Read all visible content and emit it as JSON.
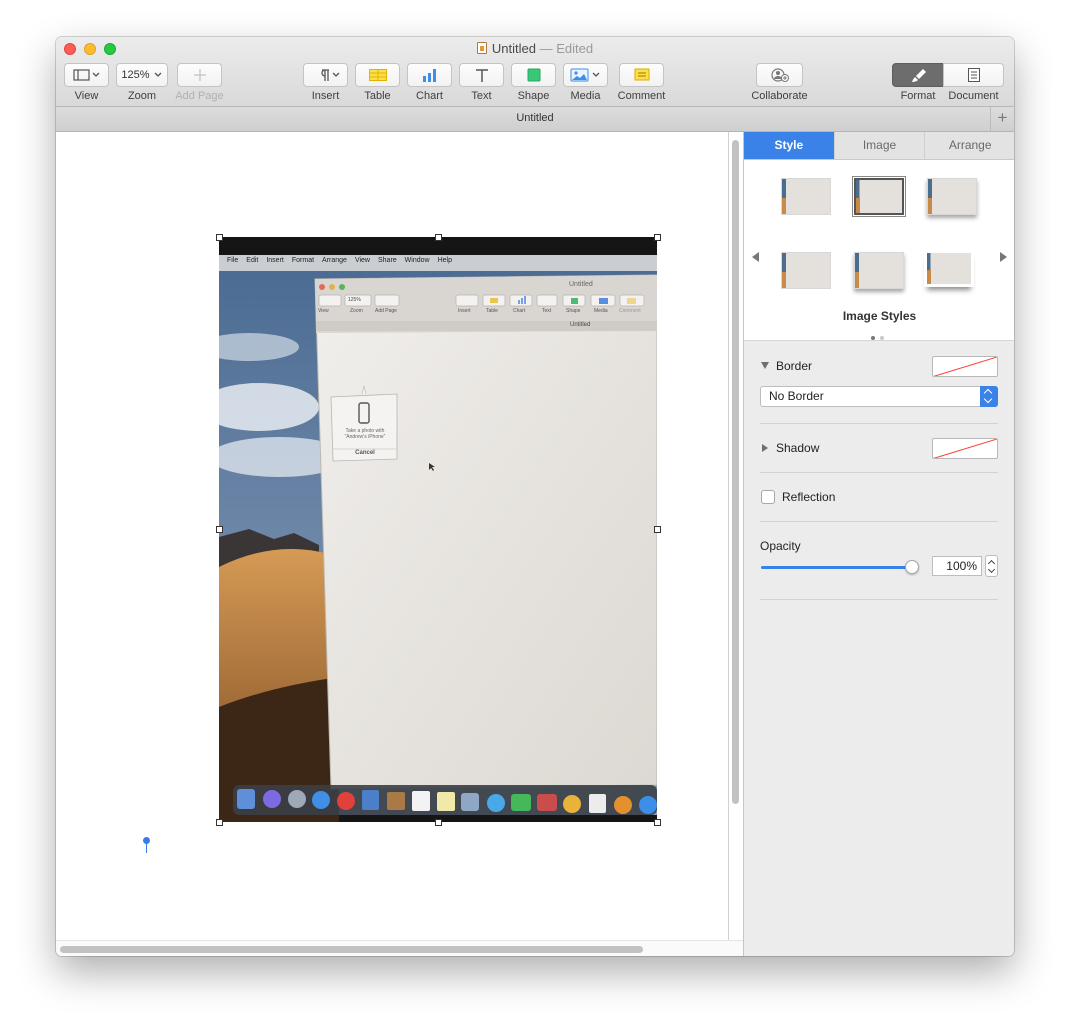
{
  "window": {
    "title": "Untitled",
    "edited_suffix": "— Edited",
    "document_tab_title": "Untitled"
  },
  "toolbar": {
    "view_label": "View",
    "zoom_label": "Zoom",
    "zoom_value": "125%",
    "add_page_label": "Add Page",
    "insert_label": "Insert",
    "table_label": "Table",
    "chart_label": "Chart",
    "text_label": "Text",
    "shape_label": "Shape",
    "media_label": "Media",
    "comment_label": "Comment",
    "collaborate_label": "Collaborate",
    "format_label": "Format",
    "document_label": "Document"
  },
  "photo_content": {
    "menu": [
      "File",
      "Edit",
      "Insert",
      "Format",
      "Arrange",
      "View",
      "Share",
      "Window",
      "Help"
    ],
    "inner_title": "Untitled",
    "inner_zoom": "125%",
    "inner_labels": [
      "View",
      "Zoom",
      "Add Page",
      "Insert",
      "Table",
      "Chart",
      "Text",
      "Shape",
      "Media",
      "Comment"
    ],
    "inner_tab": "Untitled",
    "popover_text_1": "Take a photo with",
    "popover_text_2": "“Andrew's iPhone”",
    "popover_cancel": "Cancel"
  },
  "inspector": {
    "tabs": [
      "Style",
      "Image",
      "Arrange"
    ],
    "active_tab": "Style",
    "image_styles_label": "Image Styles",
    "border_label": "Border",
    "border_style_value": "No Border",
    "shadow_label": "Shadow",
    "reflection_label": "Reflection",
    "reflection_checked": false,
    "opacity_label": "Opacity",
    "opacity_value": "100%",
    "opacity_fraction": 1.0
  },
  "colors": {
    "accent": "#3b82e8",
    "close": "#fd5d55",
    "minimize": "#fdbb2f",
    "maximize": "#28c840"
  }
}
